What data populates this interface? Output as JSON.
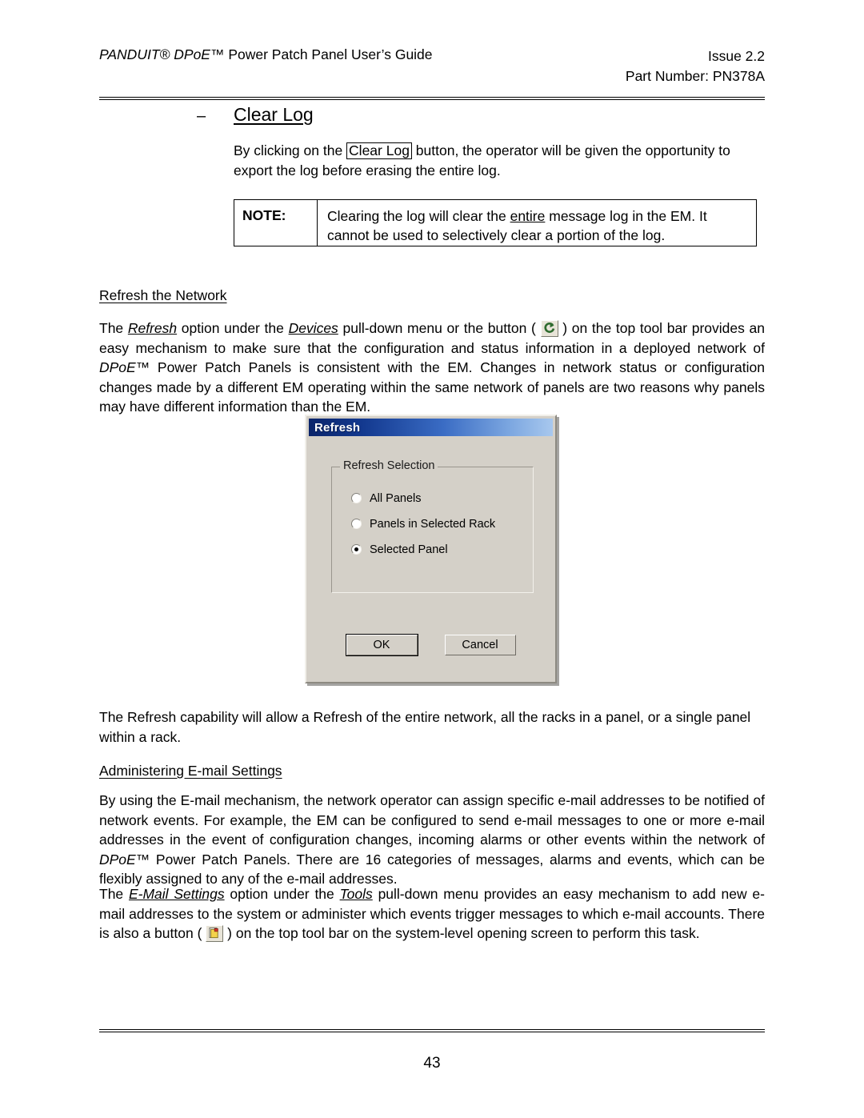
{
  "header": {
    "left_text_italic": "PANDUIT® DPoE™",
    "left_text_rest": " Power Patch Panel User’s Guide",
    "issue": "Issue 2.2",
    "part_number": "Part Number: PN378A"
  },
  "section": {
    "bullet_dash": "–",
    "heading": "Clear Log"
  },
  "clear_log_paragraph": {
    "before_button": "By clicking on the ",
    "button_label": "Clear Log",
    "after_button": " button, the operator will be given the opportunity to export the log before erasing the entire log."
  },
  "note": {
    "label": "NOTE:",
    "text_part1": "Clearing the log will clear the ",
    "text_emphasis": "entire",
    "text_part2": " message log in the EM.  It cannot be used to selectively clear a portion of the log."
  },
  "refresh_section": {
    "subheading": "Refresh the Network",
    "p1_a": "The ",
    "p1_refresh": "Refresh",
    "p1_b": " option under the ",
    "p1_devices": "Devices",
    "p1_c": " pull-down menu or the button ( ",
    "p1_icon": "refresh-toolbar-icon",
    "p1_d": " ) on the top tool bar provides an easy mechanism to make sure that the configuration and status information in a deployed network of ",
    "p1_dpoe": "DPoE™",
    "p1_e": " Power Patch Panels is consistent with the EM.  Changes in network status or configuration changes made by a different EM operating within the same network of panels are two reasons why panels may have different information than the EM.",
    "p2": "The Refresh capability will allow a Refresh of the entire network, all the racks in a panel, or a single panel within a rack."
  },
  "dialog": {
    "title": "Refresh",
    "groupbox_label": "Refresh Selection",
    "options": [
      {
        "label": "All Panels",
        "checked": false
      },
      {
        "label": "Panels in Selected Rack",
        "checked": false
      },
      {
        "label": "Selected Panel",
        "checked": true
      }
    ],
    "ok_label": "OK",
    "cancel_label": "Cancel",
    "titlebar_color_start": "#0a246a",
    "titlebar_color_end": "#a8c8ee",
    "face_color": "#d4d0c8"
  },
  "email_section": {
    "subheading": "Administering E-mail Settings",
    "p1_a": "By using the E-mail mechanism, the network operator can assign specific e-mail addresses to be notified of network events.  For example, the EM can be configured to send e-mail messages to one or more e-mail addresses in the event of configuration changes, incoming alarms or other events within the network of ",
    "p1_dpoe": "DPoE™",
    "p1_b": " Power Patch Panels.  There are 16 categories of messages, alarms and events, which can be flexibly assigned to any of the e-mail addresses.",
    "p2_a": "The ",
    "p2_emailsettings": "E-Mail Settings",
    "p2_b": " option under the ",
    "p2_tools": "Tools",
    "p2_c": " pull-down menu provides an easy mechanism to add new e-mail addresses to the system or administer which events trigger messages to which e-mail accounts.",
    "p3_a": "There is also a button ( ",
    "p3_icon": "email-toolbar-icon",
    "p3_b": " ) on the top tool bar on the system-level opening screen to perform this task."
  },
  "footer": {
    "page_number": "43"
  }
}
